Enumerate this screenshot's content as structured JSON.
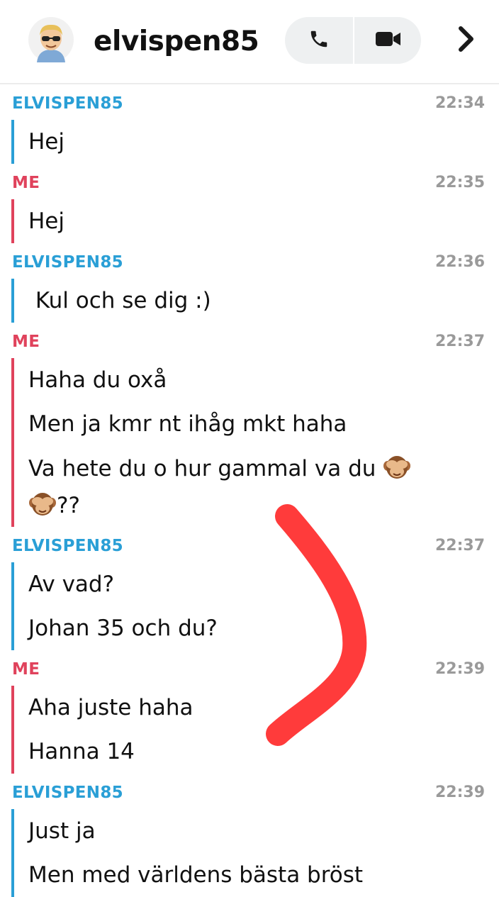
{
  "header": {
    "username": "elvispen85",
    "avatar": "bitmoji-avatar",
    "phone_icon": "phone-icon",
    "video_icon": "video-camera-icon",
    "forward_icon": "chevron-right-icon"
  },
  "colors": {
    "them": "#2a9fd6",
    "me": "#e0425c",
    "timestamp": "#9a9a9a",
    "annotation": "#ff3b3b"
  },
  "messages": [
    {
      "sender": "ELVISPEN85",
      "time": "22:34",
      "lines": [
        "Hej"
      ]
    },
    {
      "sender": "ME",
      "time": "22:35",
      "lines": [
        "Hej"
      ]
    },
    {
      "sender": "ELVISPEN85",
      "time": "22:36",
      "lines": [
        " Kul och se dig :)"
      ]
    },
    {
      "sender": "ME",
      "time": "22:37",
      "lines": [
        "Haha du oxå",
        "Men ja kmr nt ihåg mkt haha",
        "Va hete du o hur gammal va du",
        "??"
      ]
    },
    {
      "sender": "ELVISPEN85",
      "time": "22:37",
      "lines": [
        "Av vad?",
        "Johan 35 och du?"
      ]
    },
    {
      "sender": "ME",
      "time": "22:39",
      "lines": [
        "Aha juste haha",
        "Hanna 14"
      ]
    },
    {
      "sender": "ELVISPEN85",
      "time": "22:39",
      "lines": [
        "Just ja",
        "Men med världens bästa bröst"
      ]
    }
  ]
}
